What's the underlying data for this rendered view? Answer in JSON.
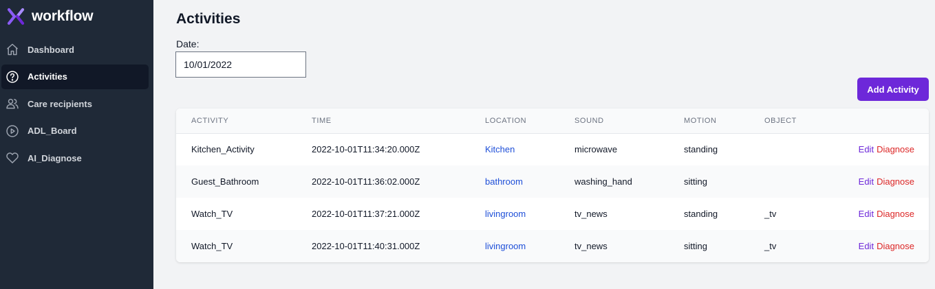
{
  "app": {
    "brand": "workflow"
  },
  "colors": {
    "sidebar_bg": "#1f2937",
    "accent": "#6d28d9",
    "link_blue": "#1d4ed8",
    "danger": "#dc2626"
  },
  "sidebar": {
    "items": [
      {
        "label": "Dashboard",
        "icon": "home-icon",
        "active": false
      },
      {
        "label": "Activities",
        "icon": "question-circle-icon",
        "active": true
      },
      {
        "label": "Care recipients",
        "icon": "users-icon",
        "active": false
      },
      {
        "label": "ADL_Board",
        "icon": "play-circle-icon",
        "active": false
      },
      {
        "label": "AI_Diagnose",
        "icon": "heart-icon",
        "active": false
      }
    ]
  },
  "main": {
    "title": "Activities",
    "date_label": "Date:",
    "date_value": "10/01/2022",
    "add_button": "Add Activity",
    "table": {
      "headers": [
        "ACTIVITY",
        "TIME",
        "LOCATION",
        "SOUND",
        "MOTION",
        "OBJECT",
        ""
      ],
      "action_edit": "Edit",
      "action_diagnose": "Diagnose",
      "rows": [
        {
          "activity": "Kitchen_Activity",
          "time": "2022-10-01T11:34:20.000Z",
          "location": "Kitchen",
          "sound": "microwave",
          "motion": "standing",
          "object": ""
        },
        {
          "activity": "Guest_Bathroom",
          "time": "2022-10-01T11:36:02.000Z",
          "location": "bathroom",
          "sound": "washing_hand",
          "motion": "sitting",
          "object": ""
        },
        {
          "activity": "Watch_TV",
          "time": "2022-10-01T11:37:21.000Z",
          "location": "livingroom",
          "sound": "tv_news",
          "motion": "standing",
          "object": "_tv"
        },
        {
          "activity": "Watch_TV",
          "time": "2022-10-01T11:40:31.000Z",
          "location": "livingroom",
          "sound": "tv_news",
          "motion": "sitting",
          "object": "_tv"
        }
      ]
    }
  }
}
